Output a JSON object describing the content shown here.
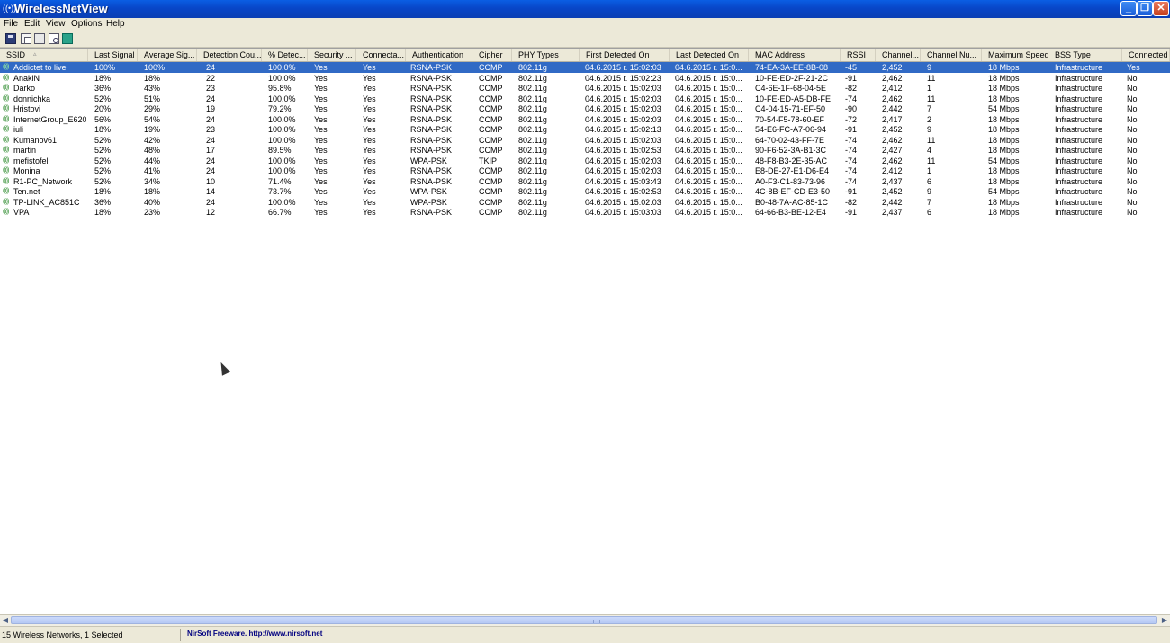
{
  "window": {
    "title": "WirelessNetView",
    "min": "_",
    "max": "❐",
    "close": "✕"
  },
  "menu": [
    "File",
    "Edit",
    "View",
    "Options",
    "Help"
  ],
  "columns": [
    "SSID",
    "Last Signal",
    "Average Sig...",
    "Detection Cou...",
    "% Detec...",
    "Security ...",
    "Connecta...",
    "Authentication",
    "Cipher",
    "PHY Types",
    "First Detected On",
    "Last Detected On",
    "MAC Address",
    "RSSI",
    "Channel...",
    "Channel Nu...",
    "Maximum Speed",
    "BSS Type",
    "Connected"
  ],
  "rows": [
    [
      "Addictet to live",
      "100%",
      "100%",
      "24",
      "100.0%",
      "Yes",
      "Yes",
      "RSNA-PSK",
      "CCMP",
      "802.11g",
      "04.6.2015 г. 15:02:03",
      "04.6.2015 г. 15:0...",
      "74-EA-3A-EE-8B-08",
      "-45",
      "2,452",
      "9",
      "18 Mbps",
      "Infrastructure",
      "Yes"
    ],
    [
      "AnakiN",
      "18%",
      "18%",
      "22",
      "100.0%",
      "Yes",
      "Yes",
      "RSNA-PSK",
      "CCMP",
      "802.11g",
      "04.6.2015 г. 15:02:23",
      "04.6.2015 г. 15:0...",
      "10-FE-ED-2F-21-2C",
      "-91",
      "2,462",
      "11",
      "18 Mbps",
      "Infrastructure",
      "No"
    ],
    [
      "Darko",
      "36%",
      "43%",
      "23",
      "95.8%",
      "Yes",
      "Yes",
      "RSNA-PSK",
      "CCMP",
      "802.11g",
      "04.6.2015 г. 15:02:03",
      "04.6.2015 г. 15:0...",
      "C4-6E-1F-68-04-5E",
      "-82",
      "2,412",
      "1",
      "18 Mbps",
      "Infrastructure",
      "No"
    ],
    [
      "donnichka",
      "52%",
      "51%",
      "24",
      "100.0%",
      "Yes",
      "Yes",
      "RSNA-PSK",
      "CCMP",
      "802.11g",
      "04.6.2015 г. 15:02:03",
      "04.6.2015 г. 15:0...",
      "10-FE-ED-A5-DB-FE",
      "-74",
      "2,462",
      "11",
      "18 Mbps",
      "Infrastructure",
      "No"
    ],
    [
      "Hristovi",
      "20%",
      "29%",
      "19",
      "79.2%",
      "Yes",
      "Yes",
      "RSNA-PSK",
      "CCMP",
      "802.11g",
      "04.6.2015 г. 15:02:03",
      "04.6.2015 г. 15:0...",
      "C4-04-15-71-EF-50",
      "-90",
      "2,442",
      "7",
      "54 Mbps",
      "Infrastructure",
      "No"
    ],
    [
      "InternetGroup_E620",
      "56%",
      "54%",
      "24",
      "100.0%",
      "Yes",
      "Yes",
      "RSNA-PSK",
      "CCMP",
      "802.11g",
      "04.6.2015 г. 15:02:03",
      "04.6.2015 г. 15:0...",
      "70-54-F5-78-60-EF",
      "-72",
      "2,417",
      "2",
      "18 Mbps",
      "Infrastructure",
      "No"
    ],
    [
      "iuli",
      "18%",
      "19%",
      "23",
      "100.0%",
      "Yes",
      "Yes",
      "RSNA-PSK",
      "CCMP",
      "802.11g",
      "04.6.2015 г. 15:02:13",
      "04.6.2015 г. 15:0...",
      "54-E6-FC-A7-06-94",
      "-91",
      "2,452",
      "9",
      "18 Mbps",
      "Infrastructure",
      "No"
    ],
    [
      "Kumanov61",
      "52%",
      "42%",
      "24",
      "100.0%",
      "Yes",
      "Yes",
      "RSNA-PSK",
      "CCMP",
      "802.11g",
      "04.6.2015 г. 15:02:03",
      "04.6.2015 г. 15:0...",
      "64-70-02-43-FF-7E",
      "-74",
      "2,462",
      "11",
      "18 Mbps",
      "Infrastructure",
      "No"
    ],
    [
      "martin",
      "52%",
      "48%",
      "17",
      "89.5%",
      "Yes",
      "Yes",
      "RSNA-PSK",
      "CCMP",
      "802.11g",
      "04.6.2015 г. 15:02:53",
      "04.6.2015 г. 15:0...",
      "90-F6-52-3A-B1-3C",
      "-74",
      "2,427",
      "4",
      "18 Mbps",
      "Infrastructure",
      "No"
    ],
    [
      "mefistofel",
      "52%",
      "44%",
      "24",
      "100.0%",
      "Yes",
      "Yes",
      "WPA-PSK",
      "TKIP",
      "802.11g",
      "04.6.2015 г. 15:02:03",
      "04.6.2015 г. 15:0...",
      "48-F8-B3-2E-35-AC",
      "-74",
      "2,462",
      "11",
      "54 Mbps",
      "Infrastructure",
      "No"
    ],
    [
      "Monina",
      "52%",
      "41%",
      "24",
      "100.0%",
      "Yes",
      "Yes",
      "RSNA-PSK",
      "CCMP",
      "802.11g",
      "04.6.2015 г. 15:02:03",
      "04.6.2015 г. 15:0...",
      "E8-DE-27-E1-D6-E4",
      "-74",
      "2,412",
      "1",
      "18 Mbps",
      "Infrastructure",
      "No"
    ],
    [
      "R1-PC_Network",
      "52%",
      "34%",
      "10",
      "71.4%",
      "Yes",
      "Yes",
      "RSNA-PSK",
      "CCMP",
      "802.11g",
      "04.6.2015 г. 15:03:43",
      "04.6.2015 г. 15:0...",
      "A0-F3-C1-83-73-96",
      "-74",
      "2,437",
      "6",
      "18 Mbps",
      "Infrastructure",
      "No"
    ],
    [
      "Ten.net",
      "18%",
      "18%",
      "14",
      "73.7%",
      "Yes",
      "Yes",
      "WPA-PSK",
      "CCMP",
      "802.11g",
      "04.6.2015 г. 15:02:53",
      "04.6.2015 г. 15:0...",
      "4C-8B-EF-CD-E3-50",
      "-91",
      "2,452",
      "9",
      "54 Mbps",
      "Infrastructure",
      "No"
    ],
    [
      "TP-LINK_AC851C",
      "36%",
      "40%",
      "24",
      "100.0%",
      "Yes",
      "Yes",
      "WPA-PSK",
      "CCMP",
      "802.11g",
      "04.6.2015 г. 15:02:03",
      "04.6.2015 г. 15:0...",
      "B0-48-7A-AC-85-1C",
      "-82",
      "2,442",
      "7",
      "18 Mbps",
      "Infrastructure",
      "No"
    ],
    [
      "VPA",
      "18%",
      "23%",
      "12",
      "66.7%",
      "Yes",
      "Yes",
      "RSNA-PSK",
      "CCMP",
      "802.11g",
      "04.6.2015 г. 15:03:03",
      "04.6.2015 г. 15:0...",
      "64-66-B3-BE-12-E4",
      "-91",
      "2,437",
      "6",
      "18 Mbps",
      "Infrastructure",
      "No"
    ]
  ],
  "selected_row": 0,
  "status": {
    "left": "15 Wireless Networks, 1 Selected",
    "link": "NirSoft Freeware.  http://www.nirsoft.net"
  },
  "icons": {
    "app": "wifi-icon",
    "row": "wifi-signal-icon",
    "toolbar": [
      "save-icon",
      "copy-icon",
      "properties-icon",
      "find-icon",
      "exit-icon"
    ]
  },
  "colors": {
    "titlebar": "#0846c8",
    "selection": "#316ac5",
    "link": "#000080"
  }
}
